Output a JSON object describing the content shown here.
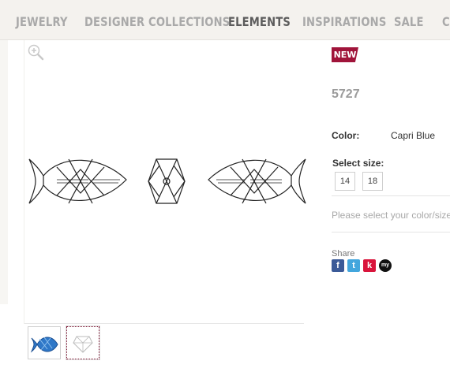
{
  "nav": {
    "items": [
      "JEWELRY",
      "DESIGNER COLLECTIONS",
      "ELEMENTS",
      "INSPIRATIONS",
      "SALE",
      "C"
    ],
    "active": "ELEMENTS"
  },
  "product": {
    "badge": "NEW",
    "sku": "5727",
    "color_label": "Color:",
    "color_value": "Capri Blue",
    "size_label": "Select size:",
    "sizes": [
      "14",
      "18"
    ],
    "prompt": "Please select your color/size",
    "share_label": "Share",
    "share_icons": [
      "facebook-icon",
      "twitter-icon",
      "kaboodle-icon",
      "myspace-icon"
    ],
    "accent_color": "#a0143a",
    "swatch_color": "#2f78c8"
  }
}
